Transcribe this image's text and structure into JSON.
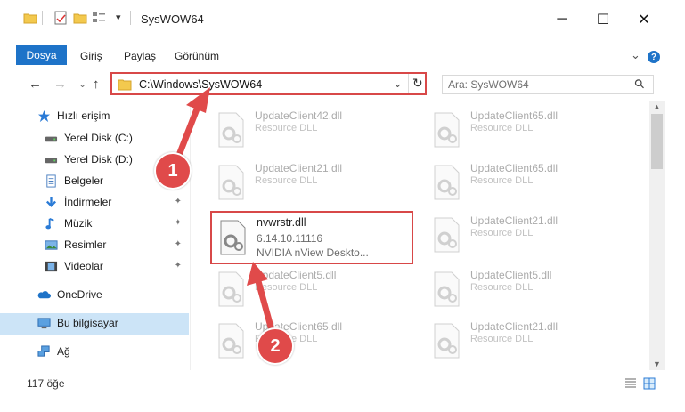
{
  "window": {
    "title": "SysWOW64",
    "minimize": "─",
    "maximize": "☐",
    "close": "✕"
  },
  "ribbon": {
    "tabs": [
      "Dosya",
      "Giriş",
      "Paylaş",
      "Görünüm"
    ],
    "expand": "⌄",
    "help": "?"
  },
  "nav": {
    "back": "←",
    "forward": "→",
    "recent": "⌄",
    "up": "↑",
    "address": "C:\\Windows\\SysWOW64",
    "address_dropdown": "⌄",
    "refresh": "↻",
    "search_placeholder": "Ara: SysWOW64",
    "search_icon": "⚲"
  },
  "sidebar": {
    "items": [
      {
        "label": "Hızlı erişim",
        "icon": "star-icon",
        "pinned": false
      },
      {
        "label": "Yerel Disk (C:)",
        "icon": "drive-icon",
        "pinned": false
      },
      {
        "label": "Yerel Disk (D:)",
        "icon": "drive-icon",
        "pinned": false
      },
      {
        "label": "Belgeler",
        "icon": "documents-icon",
        "pinned": false
      },
      {
        "label": "İndirmeler",
        "icon": "download-icon",
        "pinned": true
      },
      {
        "label": "Müzik",
        "icon": "music-icon",
        "pinned": true
      },
      {
        "label": "Resimler",
        "icon": "pictures-icon",
        "pinned": true
      },
      {
        "label": "Videolar",
        "icon": "video-icon",
        "pinned": true
      },
      {
        "label": "OneDrive",
        "icon": "cloud-icon",
        "pinned": false
      },
      {
        "label": "Bu bilgisayar",
        "icon": "computer-icon",
        "pinned": false
      },
      {
        "label": "Ağ",
        "icon": "network-icon",
        "pinned": false
      }
    ],
    "pin_glyph": "📌"
  },
  "files": [
    {
      "name": "UpdateClient42.dll",
      "desc": "Resource DLL"
    },
    {
      "name": "UpdateClient65.dll",
      "desc": "Resource DLL"
    },
    {
      "name": "UpdateClient21.dll",
      "desc": "Resource DLL"
    },
    {
      "name": "UpdateClient65.dll",
      "desc": "Resource DLL"
    },
    {
      "name": "UpdateClient21.dll",
      "desc": "Resource DLL"
    },
    {
      "name": "UpdateClient5.dll",
      "desc": "Resource DLL"
    },
    {
      "name": "UpdateClient5.dll",
      "desc": "Resource DLL"
    },
    {
      "name": "UpdateClient65.dll",
      "desc": "Resource DLL"
    },
    {
      "name": "UpdateClient21.dll",
      "desc": "Resource DLL"
    }
  ],
  "selected_file": {
    "name": "nvwrstr.dll",
    "version": "6.14.10.11116",
    "description": "NVIDIA nView Deskto..."
  },
  "status": {
    "count": "117 öğe"
  },
  "annotations": {
    "step1": "1",
    "step2": "2",
    "color": "#e04a4a"
  }
}
